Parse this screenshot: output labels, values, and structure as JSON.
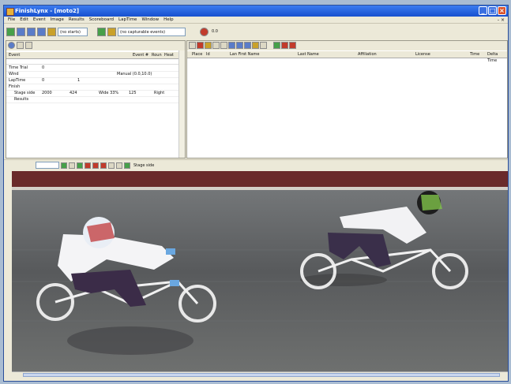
{
  "window": {
    "title": "FinishLynx - [moto2]",
    "menu": [
      "File",
      "Edit",
      "Event",
      "Image",
      "Results",
      "Scoreboard",
      "LapTime",
      "Window",
      "Help"
    ],
    "mdi_controls": "- ×"
  },
  "toolbar": {
    "starts_field": "(no starts)",
    "events_field": "(no capturable events)",
    "zoom_value": "0.0"
  },
  "event_panel": {
    "headers": {
      "event": "Event",
      "event_no": "Event #",
      "round": "Roun",
      "heat": "Heat"
    },
    "rows": [
      {
        "label": "Time Trial",
        "c1": "0",
        "c2": "",
        "c3": "",
        "c4": ""
      },
      {
        "label": "Wind",
        "c1": "",
        "c2": "",
        "c3": "Manual (0.0,10.0)",
        "c4": ""
      },
      {
        "label": "LapTime",
        "c1": "0",
        "c2": "1",
        "c3": "",
        "c4": ""
      },
      {
        "label": "Finish",
        "c1": "",
        "c2": "",
        "c3": "",
        "c4": ""
      },
      {
        "label": "Stage side",
        "c1": "2000",
        "c2": "424",
        "c3": "Wide 33%",
        "c4": "125",
        "c5": "Right"
      },
      {
        "label": "Results",
        "c1": "",
        "c2": "",
        "c3": "",
        "c4": ""
      }
    ]
  },
  "results_panel": {
    "headers": [
      "Place",
      "Id",
      "Lan First Name",
      "Last Name",
      "Affiliation",
      "License",
      "Time",
      "Delta Time"
    ]
  },
  "image_strip": {
    "label": "Stage side"
  },
  "colors": {
    "titlebar": "#1f5fd8",
    "chrome": "#ece9d8",
    "track": "#5b5b5b",
    "banner": "#6a2a2a"
  }
}
